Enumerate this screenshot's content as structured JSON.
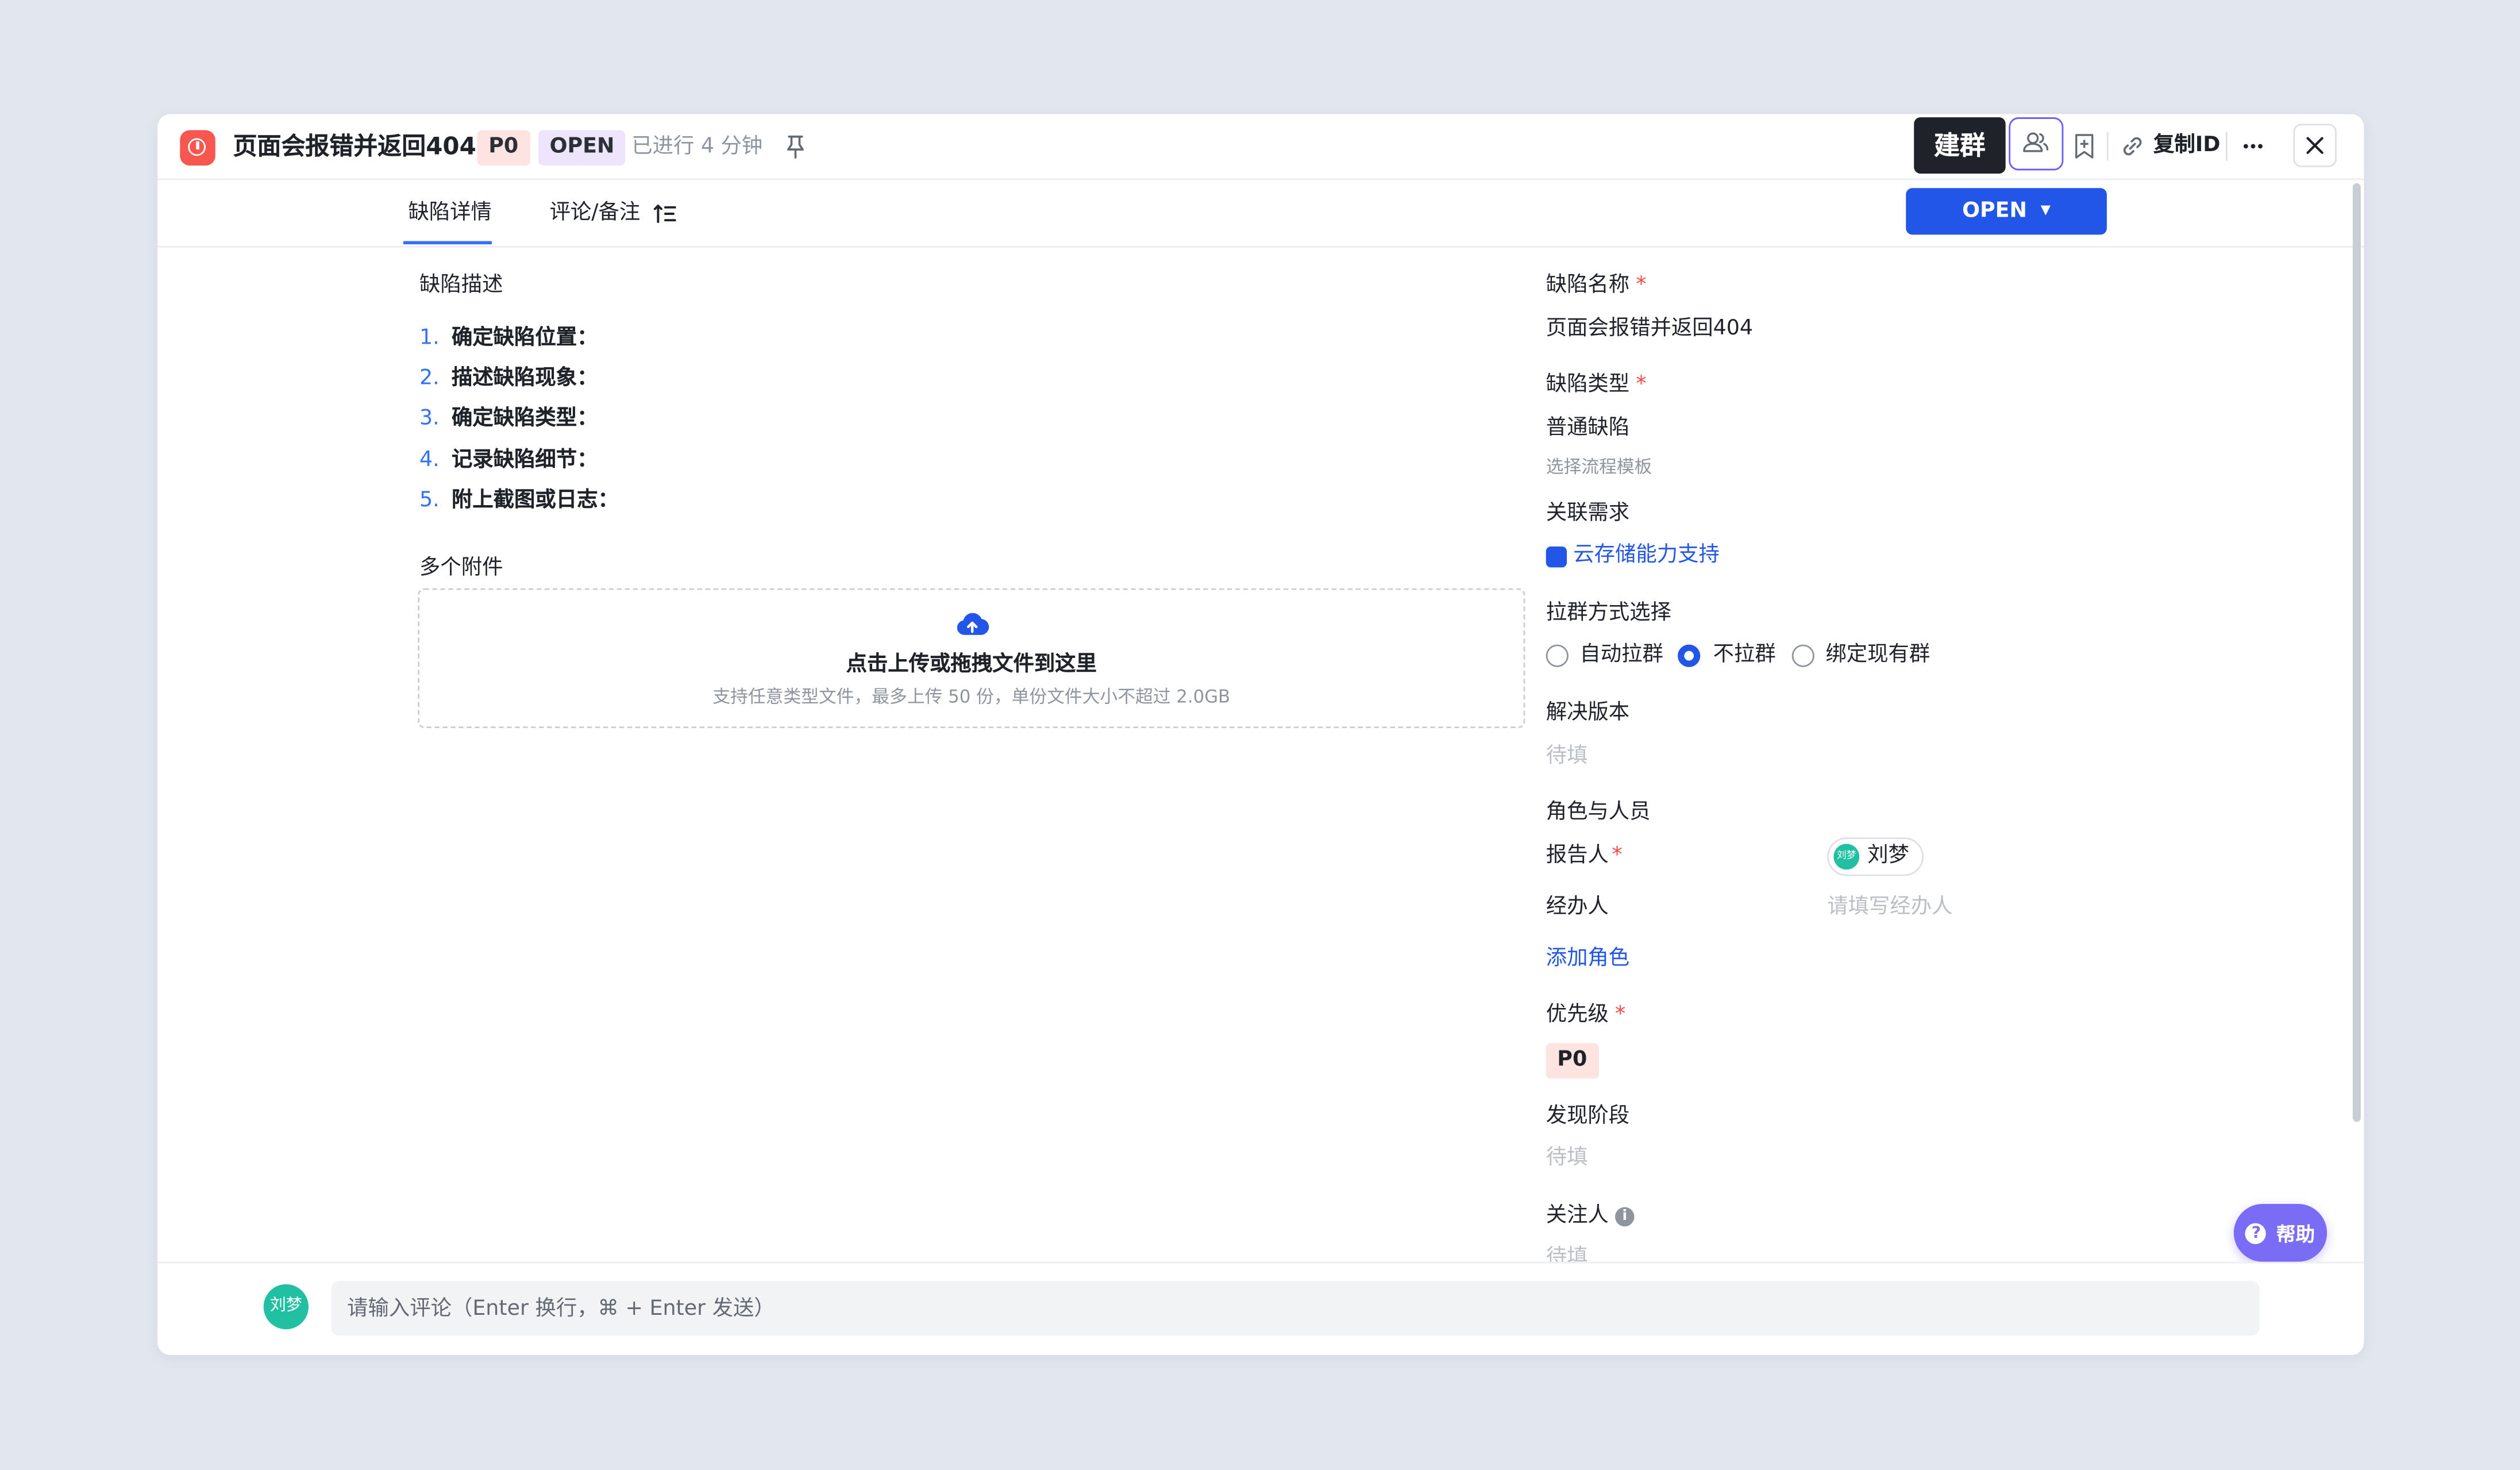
{
  "header": {
    "title": "页面会报错并返回404",
    "priority_tag": "P0",
    "status_tag": "OPEN",
    "elapsed": "已进行 4 分钟",
    "tooltip": "建群",
    "copy_id_label": "复制ID"
  },
  "tabs": [
    {
      "label": "缺陷详情",
      "active": true
    },
    {
      "label": "评论/备注",
      "active": false
    }
  ],
  "status_button": {
    "label": "OPEN",
    "color": "#2256e8"
  },
  "description": {
    "label": "缺陷描述",
    "items": [
      {
        "num": "1.",
        "text": "确定缺陷位置："
      },
      {
        "num": "2.",
        "text": "描述缺陷现象："
      },
      {
        "num": "3.",
        "text": "确定缺陷类型："
      },
      {
        "num": "4.",
        "text": "记录缺陷细节："
      },
      {
        "num": "5.",
        "text": "附上截图或日志："
      }
    ]
  },
  "attachments": {
    "label": "多个附件",
    "upload_title": "点击上传或拖拽文件到这里",
    "upload_hint": "支持任意类型文件，最多上传 50 份，单份文件大小不超过 2.0GB"
  },
  "fields": {
    "name_label": "缺陷名称",
    "name_value": "页面会报错并返回404",
    "type_label": "缺陷类型",
    "type_value": "普通缺陷",
    "type_hint": "选择流程模板",
    "related_label": "关联需求",
    "related_value": "云存储能力支持",
    "group_label": "拉群方式选择",
    "group_options": [
      {
        "label": "自动拉群",
        "selected": false
      },
      {
        "label": "不拉群",
        "selected": true
      },
      {
        "label": "绑定现有群",
        "selected": false
      }
    ],
    "version_label": "解决版本",
    "version_value": "待填",
    "roles_label": "角色与人员",
    "reporter_label": "报告人",
    "reporter_value": "刘梦",
    "handler_label": "经办人",
    "handler_placeholder": "请填写经办人",
    "add_role": "添加角色",
    "priority_label": "优先级",
    "priority_value": "P0",
    "stage_label": "发现阶段",
    "stage_value": "待填",
    "followers_label": "关注人",
    "followers_value": "待填"
  },
  "help_button": "帮助",
  "comment": {
    "avatar": "刘梦",
    "placeholder": "请输入评论（Enter 换行，⌘ + Enter 发送）"
  },
  "colors": {
    "accent": "#2256e8",
    "danger": "#f54a45",
    "help": "#7b6cf5"
  }
}
